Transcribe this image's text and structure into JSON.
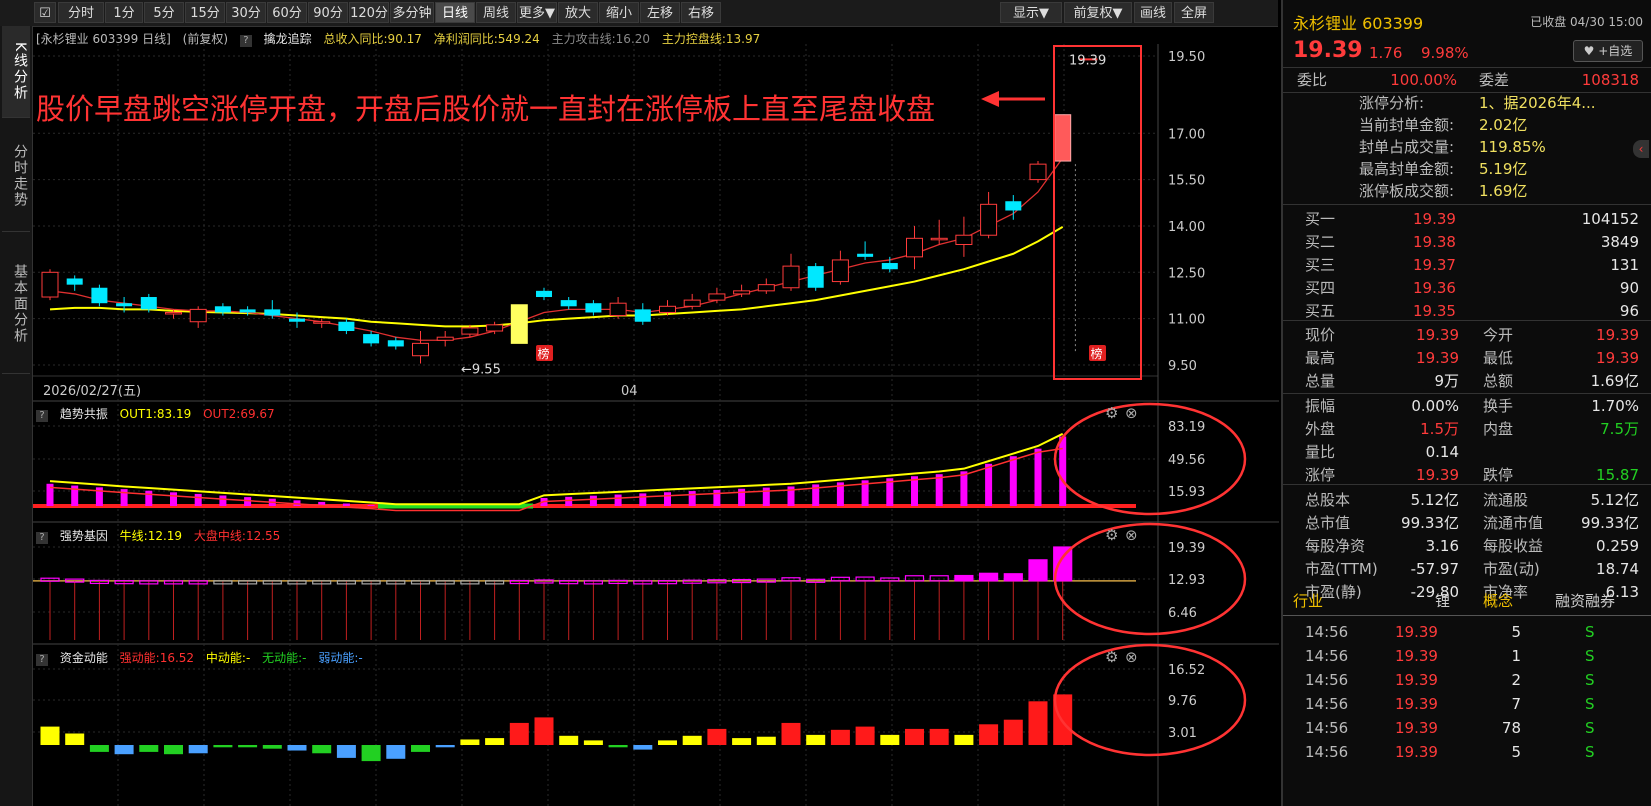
{
  "toolbar": {
    "left_buttons": [
      "分时",
      "1分",
      "5分",
      "15分",
      "30分",
      "60分",
      "90分",
      "120分",
      "多分钟",
      "日线",
      "周线",
      "更多▼",
      "放大",
      "缩小",
      "左移",
      "右移"
    ],
    "active": "日线",
    "right_buttons": [
      "显示▼",
      "前复权▼",
      "画线",
      "全屏"
    ]
  },
  "left_tabs": [
    "K线分析",
    "分时走势",
    "基本面分析"
  ],
  "main": {
    "header": {
      "stock": "[永杉锂业 603399 日线]",
      "adj": "(前复权)",
      "indicator": "擒龙追踪",
      "revenue": "总收入同比:90.17",
      "profit": "净利润同比:549.24",
      "attack": "主力攻击线:16.20",
      "control": "主力控盘线:13.97"
    },
    "annotation": "股价早盘跳空涨停开盘，开盘后股价就一直封在涨停板上直至尾盘收盘",
    "price_axis": [
      "19.50",
      "17.00",
      "15.50",
      "14.00",
      "12.50",
      "11.00",
      "9.50"
    ],
    "high_label": "19.39",
    "low_label": "9.55",
    "bang": "榜",
    "date_labels": [
      "2026/02/27(五)",
      "04"
    ],
    "panel1": {
      "name": "趋势共振",
      "l1": "OUT1:83.19",
      "l2": "OUT2:69.67",
      "axis": [
        "83.19",
        "49.56",
        "15.93"
      ]
    },
    "panel2": {
      "name": "强势基因",
      "l1": "牛线:12.19",
      "l2": "大盘中线:12.55",
      "axis": [
        "19.39",
        "12.93",
        "6.46"
      ]
    },
    "panel3": {
      "name": "资金动能",
      "l1": "强动能:16.52",
      "l2": "中动能:-",
      "l3": "无动能:-",
      "l4": "弱动能:-",
      "axis": [
        "16.52",
        "9.76",
        "3.01"
      ]
    },
    "colors": {
      "up": "#ff3b3b",
      "down": "#00e8ff",
      "ma_yellow": "#ffff00",
      "ma_red": "#e03030",
      "magenta": "#ff00ff",
      "annot": "#ff3333"
    }
  },
  "right": {
    "title": "永杉锂业 603399",
    "status": "已收盘 04/30 15:00",
    "price": "19.39",
    "change": "1.76",
    "pct": "9.98%",
    "watch": "♥ +自选",
    "weibi_l": "委比",
    "weibi_v": "100.00%",
    "weicha_l": "委差",
    "weicha_v": "108318",
    "limit_info": [
      {
        "k": "涨停分析:",
        "v": "1、据2026年4..."
      },
      {
        "k": "当前封单金额:",
        "v": "2.02亿"
      },
      {
        "k": "封单占成交量:",
        "v": "119.85%"
      },
      {
        "k": "最高封单金额:",
        "v": "5.19亿"
      },
      {
        "k": "涨停板成交额:",
        "v": "1.69亿"
      }
    ],
    "bids": [
      {
        "l": "买一",
        "p": "19.39",
        "v": "104152"
      },
      {
        "l": "买二",
        "p": "19.38",
        "v": "3849"
      },
      {
        "l": "买三",
        "p": "19.37",
        "v": "131"
      },
      {
        "l": "买四",
        "p": "19.36",
        "v": "90"
      },
      {
        "l": "买五",
        "p": "19.35",
        "v": "96"
      }
    ],
    "stats": [
      {
        "l1": "现价",
        "v1": "19.39",
        "c1": "red",
        "l2": "今开",
        "v2": "19.39",
        "c2": "red"
      },
      {
        "l1": "最高",
        "v1": "19.39",
        "c1": "red",
        "l2": "最低",
        "v2": "19.39",
        "c2": "red"
      },
      {
        "l1": "总量",
        "v1": "9万",
        "c1": "white",
        "l2": "总额",
        "v2": "1.69亿",
        "c2": "white"
      },
      {
        "l1": "振幅",
        "v1": "0.00%",
        "c1": "white",
        "l2": "换手",
        "v2": "1.70%",
        "c2": "white"
      },
      {
        "l1": "外盘",
        "v1": "1.5万",
        "c1": "red",
        "l2": "内盘",
        "v2": "7.5万",
        "c2": "green"
      },
      {
        "l1": "量比",
        "v1": "0.14",
        "c1": "white",
        "l2": "",
        "v2": "",
        "c2": "white"
      },
      {
        "l1": "涨停",
        "v1": "19.39",
        "c1": "red",
        "l2": "跌停",
        "v2": "15.87",
        "c2": "green"
      },
      {
        "l1": "总股本",
        "v1": "5.12亿",
        "c1": "white",
        "l2": "流通股",
        "v2": "5.12亿",
        "c2": "white"
      },
      {
        "l1": "总市值",
        "v1": "99.33亿",
        "c1": "white",
        "l2": "流通市值",
        "v2": "99.33亿",
        "c2": "white"
      },
      {
        "l1": "每股净资",
        "v1": "3.16",
        "c1": "white",
        "l2": "每股收益",
        "v2": "0.259",
        "c2": "white"
      },
      {
        "l1": "市盈(TTM)",
        "v1": "-57.97",
        "c1": "white",
        "l2": "市盈(动)",
        "v2": "18.74",
        "c2": "white"
      },
      {
        "l1": "市盈(静)",
        "v1": "-29.80",
        "c1": "white",
        "l2": "市净率",
        "v2": "6.13",
        "c2": "white"
      }
    ],
    "tabs": [
      "行业",
      "锂",
      "概念",
      "融资融券"
    ],
    "ticks": [
      {
        "t": "14:56",
        "p": "19.39",
        "v": "5",
        "f": "S"
      },
      {
        "t": "14:56",
        "p": "19.39",
        "v": "1",
        "f": "S"
      },
      {
        "t": "14:56",
        "p": "19.39",
        "v": "2",
        "f": "S"
      },
      {
        "t": "14:56",
        "p": "19.39",
        "v": "7",
        "f": "S"
      },
      {
        "t": "14:56",
        "p": "19.39",
        "v": "78",
        "f": "S"
      },
      {
        "t": "14:56",
        "p": "19.39",
        "v": "5",
        "f": "S"
      }
    ]
  }
}
